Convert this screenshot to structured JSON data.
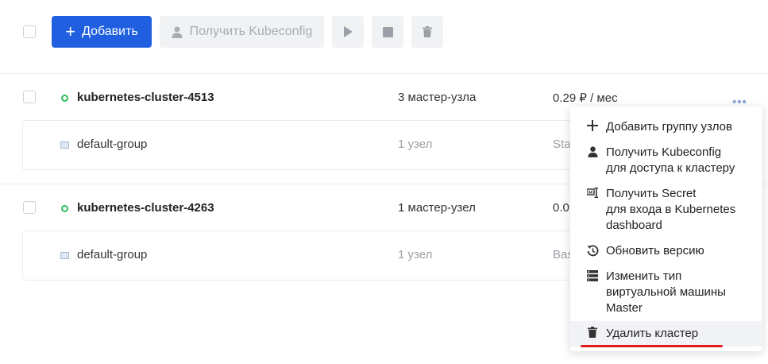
{
  "toolbar": {
    "add_label": "Добавить",
    "kubeconfig_label": "Получить Kubeconfig"
  },
  "clusters": [
    {
      "name": "kubernetes-cluster-4513",
      "masters": "3 мастер-узла",
      "price": "0.29 ₽ / мес",
      "group": {
        "name": "default-group",
        "nodes": "1 узел",
        "type": "Sta"
      }
    },
    {
      "name": "kubernetes-cluster-4263",
      "masters": "1 мастер-узел",
      "price": "0.0",
      "group": {
        "name": "default-group",
        "nodes": "1 узел",
        "type": "Bas"
      }
    }
  ],
  "menu": {
    "items": [
      {
        "label": "Добавить группу узлов",
        "icon": "plus-icon"
      },
      {
        "label": "Получить Kubeconfig\nдля доступа к кластеру",
        "icon": "user-icon"
      },
      {
        "label": "Получить Secret\nдля входа в Kubernetes\ndashboard",
        "icon": "key-icon"
      },
      {
        "label": "Обновить версию",
        "icon": "history-icon"
      },
      {
        "label": "Изменить тип\nвиртуальной машины\nMaster",
        "icon": "server-icon"
      },
      {
        "label": "Удалить кластер",
        "icon": "trash-icon"
      }
    ]
  },
  "colors": {
    "primary": "#1f5fe0",
    "status_ok": "#2fbf5a",
    "annotation_red": "#e01e1e"
  }
}
